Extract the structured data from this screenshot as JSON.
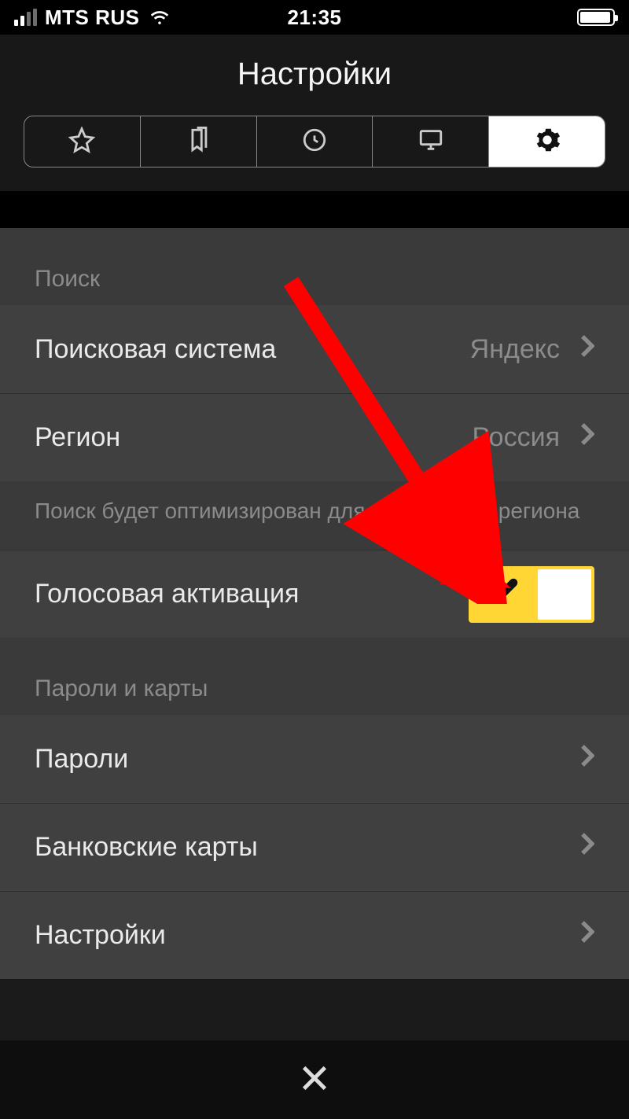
{
  "status_bar": {
    "carrier": "MTS RUS",
    "time": "21:35"
  },
  "header": {
    "title": "Настройки",
    "tabs": {
      "favorites_icon": "star-icon",
      "bookmarks_icon": "bookmarks-icon",
      "history_icon": "clock-icon",
      "tabs_panel_icon": "desktop-icon",
      "settings_icon": "gear-icon"
    }
  },
  "sections": {
    "search": {
      "title": "Поиск",
      "rows": {
        "search_engine": {
          "label": "Поисковая система",
          "value": "Яндекс"
        },
        "region": {
          "label": "Регион",
          "value": "Россия"
        }
      },
      "note": "Поиск будет оптимизирован для выбранного региона",
      "voice": {
        "label": "Голосовая активация",
        "enabled": true
      }
    },
    "passwords": {
      "title": "Пароли и карты",
      "rows": {
        "passwords": {
          "label": "Пароли"
        },
        "cards": {
          "label": "Банковские карты"
        },
        "settings": {
          "label": "Настройки"
        }
      }
    }
  },
  "colors": {
    "accent": "#ffd633",
    "arrow": "#ff0000"
  }
}
